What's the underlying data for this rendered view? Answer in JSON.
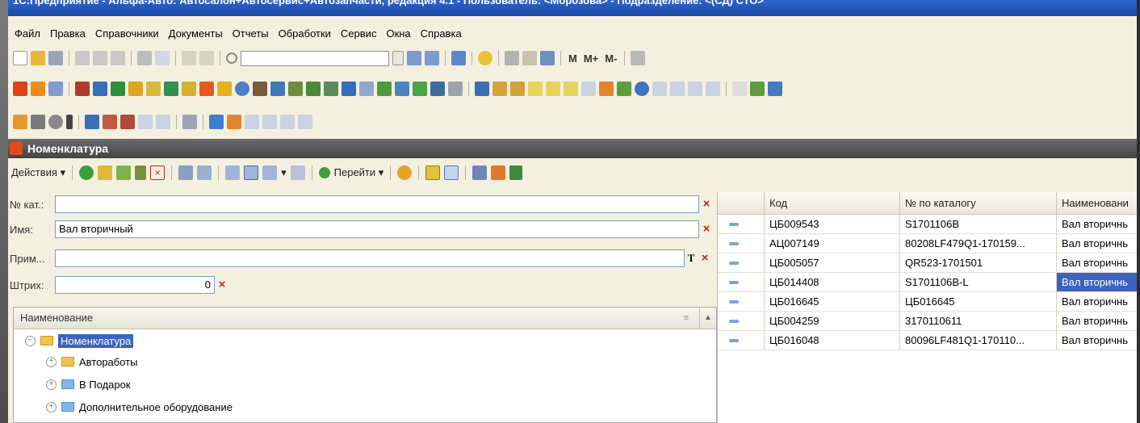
{
  "title": "1С:Предприятие - Альфа-Авто: Автосалон+Автосервис+Автозапчасти, редакция 4.1 - Пользователь: <Морозова> - Подразделение: <(СД) СТО>",
  "menu": [
    "Файл",
    "Правка",
    "Справочники",
    "Документы",
    "Отчеты",
    "Обработки",
    "Сервис",
    "Окна",
    "Справка"
  ],
  "toolbar1": {
    "memory_labels": [
      "M",
      "M+",
      "M-"
    ]
  },
  "doc_title": "Номенклатура",
  "actions": {
    "actions_label": "Действия",
    "goto_label": "Перейти"
  },
  "form": {
    "catalog_label": "№ кат.:",
    "catalog_value": "",
    "name_label": "Имя:",
    "name_value": "Вал вторичный",
    "note_label": "Прим...",
    "note_value": "",
    "note_t": "T",
    "barcode_label": "Штрих:",
    "barcode_value": "0"
  },
  "tree": {
    "header": "Наименование",
    "root": "Номенклатура",
    "children": [
      "Автоработы",
      "В Подарок",
      "Дополнительное оборудование"
    ]
  },
  "grid": {
    "columns": [
      "Код",
      "№ по каталогу",
      "Наименовани"
    ],
    "rows": [
      {
        "code": "ЦБ009543",
        "catalog": "S1701106B",
        "name": "Вал вторичнь"
      },
      {
        "code": "АЦ007149",
        "catalog": "80208LF479Q1-170159...",
        "name": "Вал вторичнь"
      },
      {
        "code": "ЦБ005057",
        "catalog": "QR523-1701501",
        "name": "Вал вторичнь"
      },
      {
        "code": "ЦБ014408",
        "catalog": "S1701106B-L",
        "name": "Вал вторичнь"
      },
      {
        "code": "ЦБ016645",
        "catalog": "ЦБ016645",
        "name": "Вал вторичнь"
      },
      {
        "code": "ЦБ004259",
        "catalog": "3170110611",
        "name": "Вал вторичнь"
      },
      {
        "code": "ЦБ016048",
        "catalog": "80096LF481Q1-170110...",
        "name": "Вал вторичнь"
      }
    ]
  }
}
